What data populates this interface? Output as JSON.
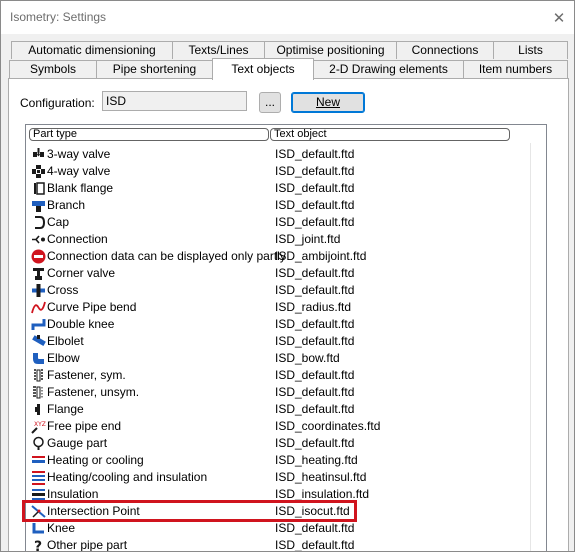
{
  "window": {
    "title": "Isometry: Settings"
  },
  "tabs_row1": [
    "Automatic dimensioning",
    "Texts/Lines",
    "Optimise positioning",
    "Connections",
    "Lists"
  ],
  "tabs_row2": [
    "Symbols",
    "Pipe shortening",
    "Text objects",
    "2-D Drawing elements",
    "Item numbers"
  ],
  "active_tab": "Text objects",
  "configuration": {
    "label": "Configuration:",
    "value": "ISD",
    "browse_label": "...",
    "new_label": "New"
  },
  "columns": [
    "Part type",
    "Text object"
  ],
  "rows": [
    {
      "part": "3-way valve",
      "obj": "ISD_default.ftd",
      "icon": "three-way-valve-icon"
    },
    {
      "part": "4-way valve",
      "obj": "ISD_default.ftd",
      "icon": "four-way-valve-icon"
    },
    {
      "part": "Blank flange",
      "obj": "ISD_default.ftd",
      "icon": "blank-flange-icon"
    },
    {
      "part": "Branch",
      "obj": "ISD_default.ftd",
      "icon": "branch-icon"
    },
    {
      "part": "Cap",
      "obj": "ISD_default.ftd",
      "icon": "cap-icon"
    },
    {
      "part": "Connection",
      "obj": "ISD_joint.ftd",
      "icon": "connection-icon"
    },
    {
      "part": "Connection data can be displayed only partly",
      "obj": "ISD_ambijoint.ftd",
      "icon": "no-entry-icon"
    },
    {
      "part": "Corner valve",
      "obj": "ISD_default.ftd",
      "icon": "corner-valve-icon"
    },
    {
      "part": "Cross",
      "obj": "ISD_default.ftd",
      "icon": "cross-icon"
    },
    {
      "part": "Curve Pipe bend",
      "obj": "ISD_radius.ftd",
      "icon": "curve-pipe-bend-icon"
    },
    {
      "part": "Double knee",
      "obj": "ISD_default.ftd",
      "icon": "double-knee-icon"
    },
    {
      "part": "Elbolet",
      "obj": "ISD_default.ftd",
      "icon": "elbolet-icon"
    },
    {
      "part": "Elbow",
      "obj": "ISD_bow.ftd",
      "icon": "elbow-icon"
    },
    {
      "part": "Fastener, sym.",
      "obj": "ISD_default.ftd",
      "icon": "fastener-sym-icon"
    },
    {
      "part": "Fastener, unsym.",
      "obj": "ISD_default.ftd",
      "icon": "fastener-unsym-icon"
    },
    {
      "part": "Flange",
      "obj": "ISD_default.ftd",
      "icon": "flange-icon"
    },
    {
      "part": "Free pipe end",
      "obj": "ISD_coordinates.ftd",
      "icon": "free-pipe-end-icon"
    },
    {
      "part": "Gauge part",
      "obj": "ISD_default.ftd",
      "icon": "gauge-part-icon"
    },
    {
      "part": "Heating or cooling",
      "obj": "ISD_heating.ftd",
      "icon": "heating-cooling-icon"
    },
    {
      "part": "Heating/cooling and insulation",
      "obj": "ISD_heatinsul.ftd",
      "icon": "heating-insulation-icon"
    },
    {
      "part": "Insulation",
      "obj": "ISD_insulation.ftd",
      "icon": "insulation-icon"
    },
    {
      "part": "Intersection Point",
      "obj": "ISD_isocut.ftd",
      "icon": "intersection-point-icon"
    },
    {
      "part": "Knee",
      "obj": "ISD_default.ftd",
      "icon": "knee-icon"
    },
    {
      "part": "Other pipe part",
      "obj": "ISD_default.ftd",
      "icon": "question-icon"
    }
  ],
  "icon_colors": {
    "pipe": "#1a1a1a",
    "accent_blue": "#1f5fbf",
    "accent_red": "#d0141e",
    "highlight": "#d0141e"
  }
}
